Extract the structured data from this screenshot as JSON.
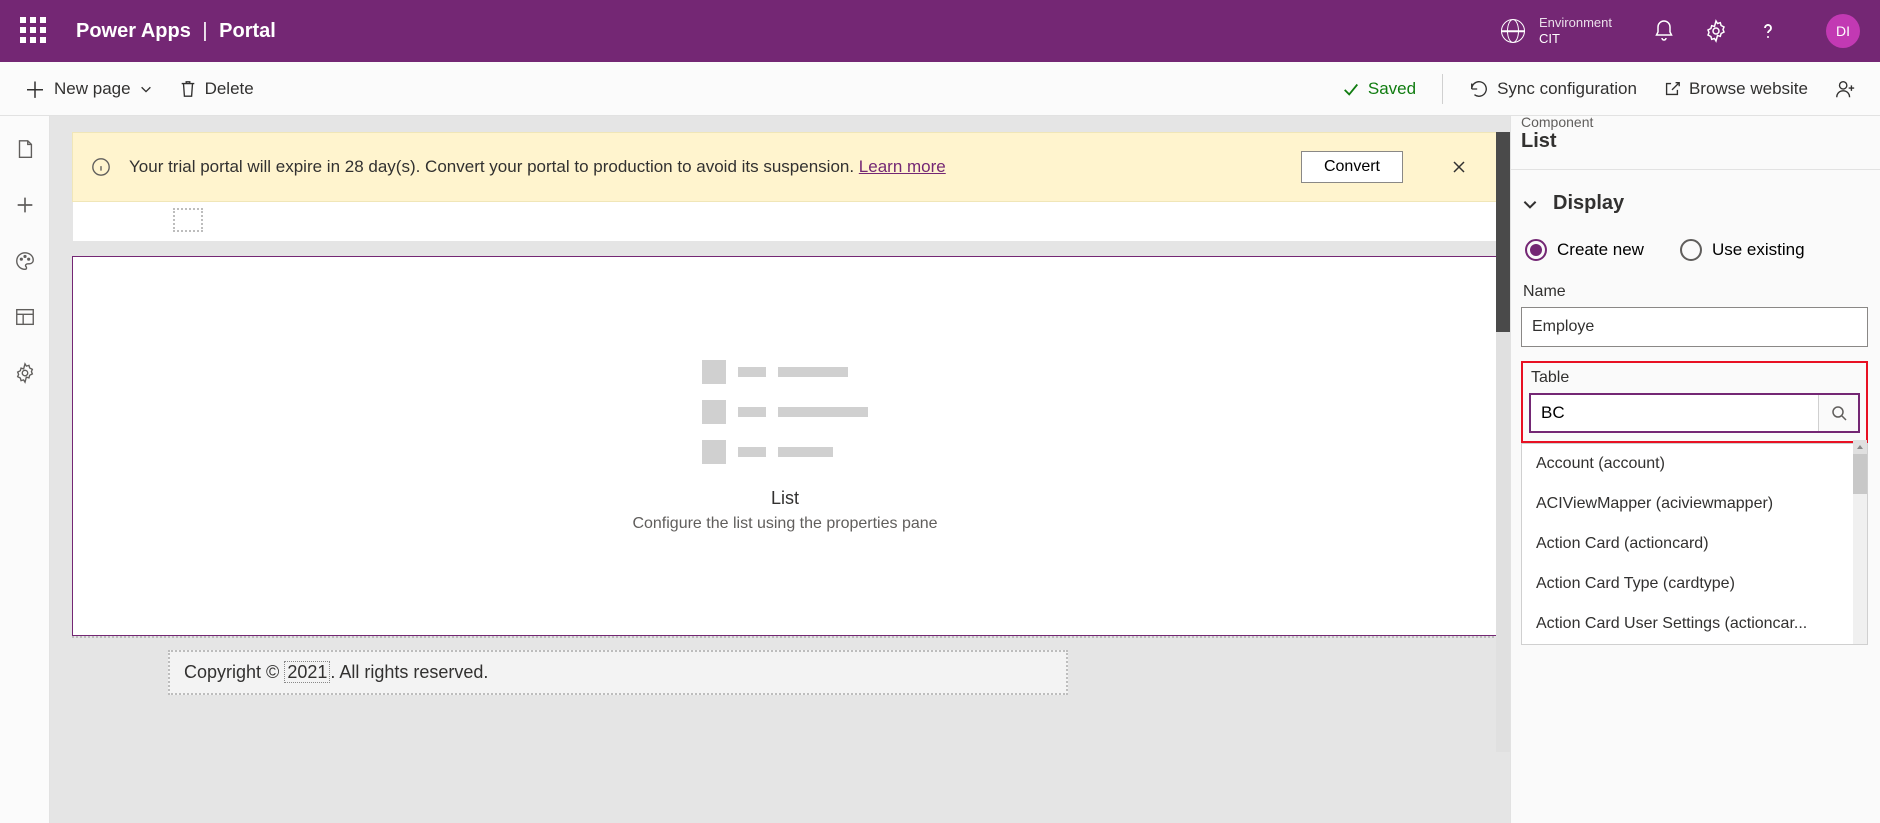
{
  "header": {
    "brand": "Power Apps",
    "page": "Portal",
    "environment_label": "Environment",
    "environment_name": "CIT",
    "avatar_initials": "DI"
  },
  "cmdbar": {
    "new_page": "New page",
    "delete": "Delete",
    "saved": "Saved",
    "sync": "Sync configuration",
    "browse": "Browse website"
  },
  "notification": {
    "text": "Your trial portal will expire in 28 day(s). Convert your portal to production to avoid its suspension. ",
    "link": "Learn more",
    "button": "Convert"
  },
  "canvas": {
    "list_title": "List",
    "list_subtitle": "Configure the list using the properties pane",
    "copyright_prefix": "Copyright © ",
    "copyright_year": "2021",
    "copyright_suffix": ". All rights reserved."
  },
  "props": {
    "component_label": "Component",
    "component_type": "List",
    "display_section": "Display",
    "create_new": "Create new",
    "use_existing": "Use existing",
    "name_label": "Name",
    "name_value": "Employe",
    "table_label": "Table",
    "table_value": "BC",
    "dropdown": [
      "Account (account)",
      "ACIViewMapper (aciviewmapper)",
      "Action Card (actioncard)",
      "Action Card Type (cardtype)",
      "Action Card User Settings (actioncar..."
    ]
  }
}
